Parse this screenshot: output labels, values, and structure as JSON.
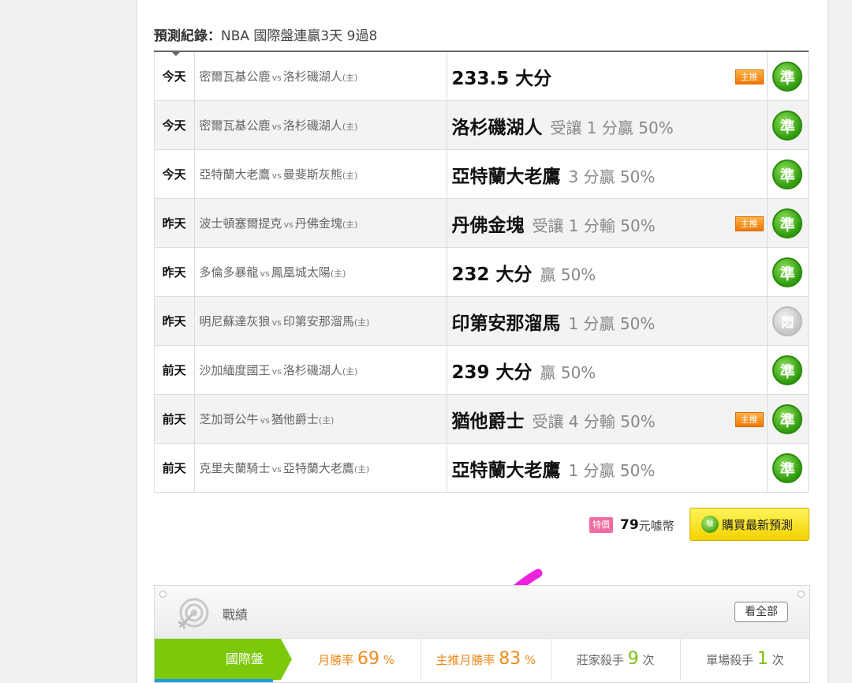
{
  "header": {
    "label": "預測紀錄：",
    "summary": "NBA 國際盤連贏3天 9過8"
  },
  "predictions": [
    {
      "day": "今天",
      "away": "密爾瓦基公鹿",
      "vs": "vs",
      "home": "洛杉磯湖人",
      "host_mark": "(主)",
      "pick": "233.5 大分",
      "detail": "",
      "featured": true,
      "result": "準"
    },
    {
      "day": "今天",
      "away": "密爾瓦基公鹿",
      "vs": "vs",
      "home": "洛杉磯湖人",
      "host_mark": "(主)",
      "pick": "洛杉磯湖人",
      "detail": "受讓 1 分贏 50%",
      "featured": false,
      "result": "準"
    },
    {
      "day": "今天",
      "away": "亞特蘭大老鷹",
      "vs": "vs",
      "home": "曼斐斯灰熊",
      "host_mark": "(主)",
      "pick": "亞特蘭大老鷹",
      "detail": "3 分贏 50%",
      "featured": false,
      "result": "準"
    },
    {
      "day": "昨天",
      "away": "波士頓塞爾提克",
      "vs": "vs",
      "home": "丹佛金塊",
      "host_mark": "(主)",
      "pick": "丹佛金塊",
      "detail": "受讓 1 分輸 50%",
      "featured": true,
      "result": "準"
    },
    {
      "day": "昨天",
      "away": "多倫多暴龍",
      "vs": "vs",
      "home": "鳳凰城太陽",
      "host_mark": "(主)",
      "pick": "232 大分",
      "detail": "贏 50%",
      "featured": false,
      "result": "準"
    },
    {
      "day": "昨天",
      "away": "明尼蘇達灰狼",
      "vs": "vs",
      "home": "印第安那溜馬",
      "host_mark": "(主)",
      "pick": "印第安那溜馬",
      "detail": "1 分贏 50%",
      "featured": false,
      "result": "悶"
    },
    {
      "day": "前天",
      "away": "沙加緬度國王",
      "vs": "vs",
      "home": "洛杉磯湖人",
      "host_mark": "(主)",
      "pick": "239 大分",
      "detail": "贏 50%",
      "featured": false,
      "result": "準"
    },
    {
      "day": "前天",
      "away": "芝加哥公牛",
      "vs": "vs",
      "home": "猶他爵士",
      "host_mark": "(主)",
      "pick": "猶他爵士",
      "detail": "受讓 4 分輸 50%",
      "featured": true,
      "result": "準"
    },
    {
      "day": "前天",
      "away": "克里夫蘭騎士",
      "vs": "vs",
      "home": "亞特蘭大老鷹",
      "host_mark": "(主)",
      "pick": "亞特蘭大老鷹",
      "detail": "1 分贏 50%",
      "featured": false,
      "result": "準"
    }
  ],
  "badge_text": "主推",
  "purchase": {
    "sale_tag": "特價",
    "price": "79",
    "unit": "元噱幣",
    "button_icon": "噱",
    "button_label": "購買最新預測"
  },
  "record": {
    "heading": "戰績",
    "see_all": "看全部",
    "tab": "國際盤",
    "stats": [
      {
        "label": "月勝率",
        "value": "69",
        "unit": "%"
      },
      {
        "label": "主推月勝率",
        "value": "83",
        "unit": "%"
      },
      {
        "label": "莊家殺手",
        "value": "9",
        "unit": "次"
      },
      {
        "label": "單場殺手",
        "value": "1",
        "unit": "次"
      }
    ]
  },
  "colors": {
    "green_tab": "#7bc90a",
    "orange_stat": "#ee8a1e",
    "featured_badge": "#ee7700",
    "check_mark": "#ee22dd"
  }
}
